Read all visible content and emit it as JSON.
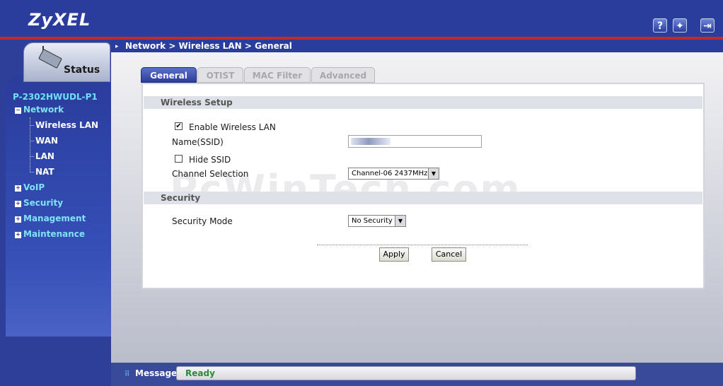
{
  "header": {
    "logo": "ZyXEL",
    "icons": [
      "help-icon",
      "wizard-icon",
      "logout-icon"
    ]
  },
  "breadcrumb": "Network > Wireless LAN > General",
  "sidebar": {
    "status_tab": "Status",
    "device_name": "P-2302HWUDL-P1",
    "items": [
      {
        "label": "Network",
        "expanded": true,
        "children": [
          "Wireless LAN",
          "WAN",
          "LAN",
          "NAT"
        ],
        "selected_child": "Wireless LAN"
      },
      {
        "label": "VoIP",
        "expanded": false
      },
      {
        "label": "Security",
        "expanded": false
      },
      {
        "label": "Management",
        "expanded": false
      },
      {
        "label": "Maintenance",
        "expanded": false
      }
    ]
  },
  "tabs": [
    {
      "label": "General",
      "active": true
    },
    {
      "label": "OTIST",
      "active": false
    },
    {
      "label": "MAC Filter",
      "active": false
    },
    {
      "label": "Advanced",
      "active": false
    }
  ],
  "wireless_setup": {
    "title": "Wireless Setup",
    "enable_label": "Enable Wireless LAN",
    "enable_checked": true,
    "ssid_label": "Name(SSID)",
    "hide_ssid_label": "Hide SSID",
    "hide_ssid_checked": false,
    "channel_label": "Channel Selection",
    "channel_value": "Channel-06 2437MHz"
  },
  "security": {
    "title": "Security",
    "mode_label": "Security Mode",
    "mode_value": "No Security"
  },
  "buttons": {
    "apply": "Apply",
    "cancel": "Cancel"
  },
  "message": {
    "label": "Message",
    "status": "Ready"
  },
  "watermark": "PcWinTech.com",
  "colors": {
    "header_blue": "#2b3d9c",
    "accent_red": "#c42a2a",
    "nav_cyan": "#7fe2f5",
    "status_green": "#2a8a3a"
  }
}
